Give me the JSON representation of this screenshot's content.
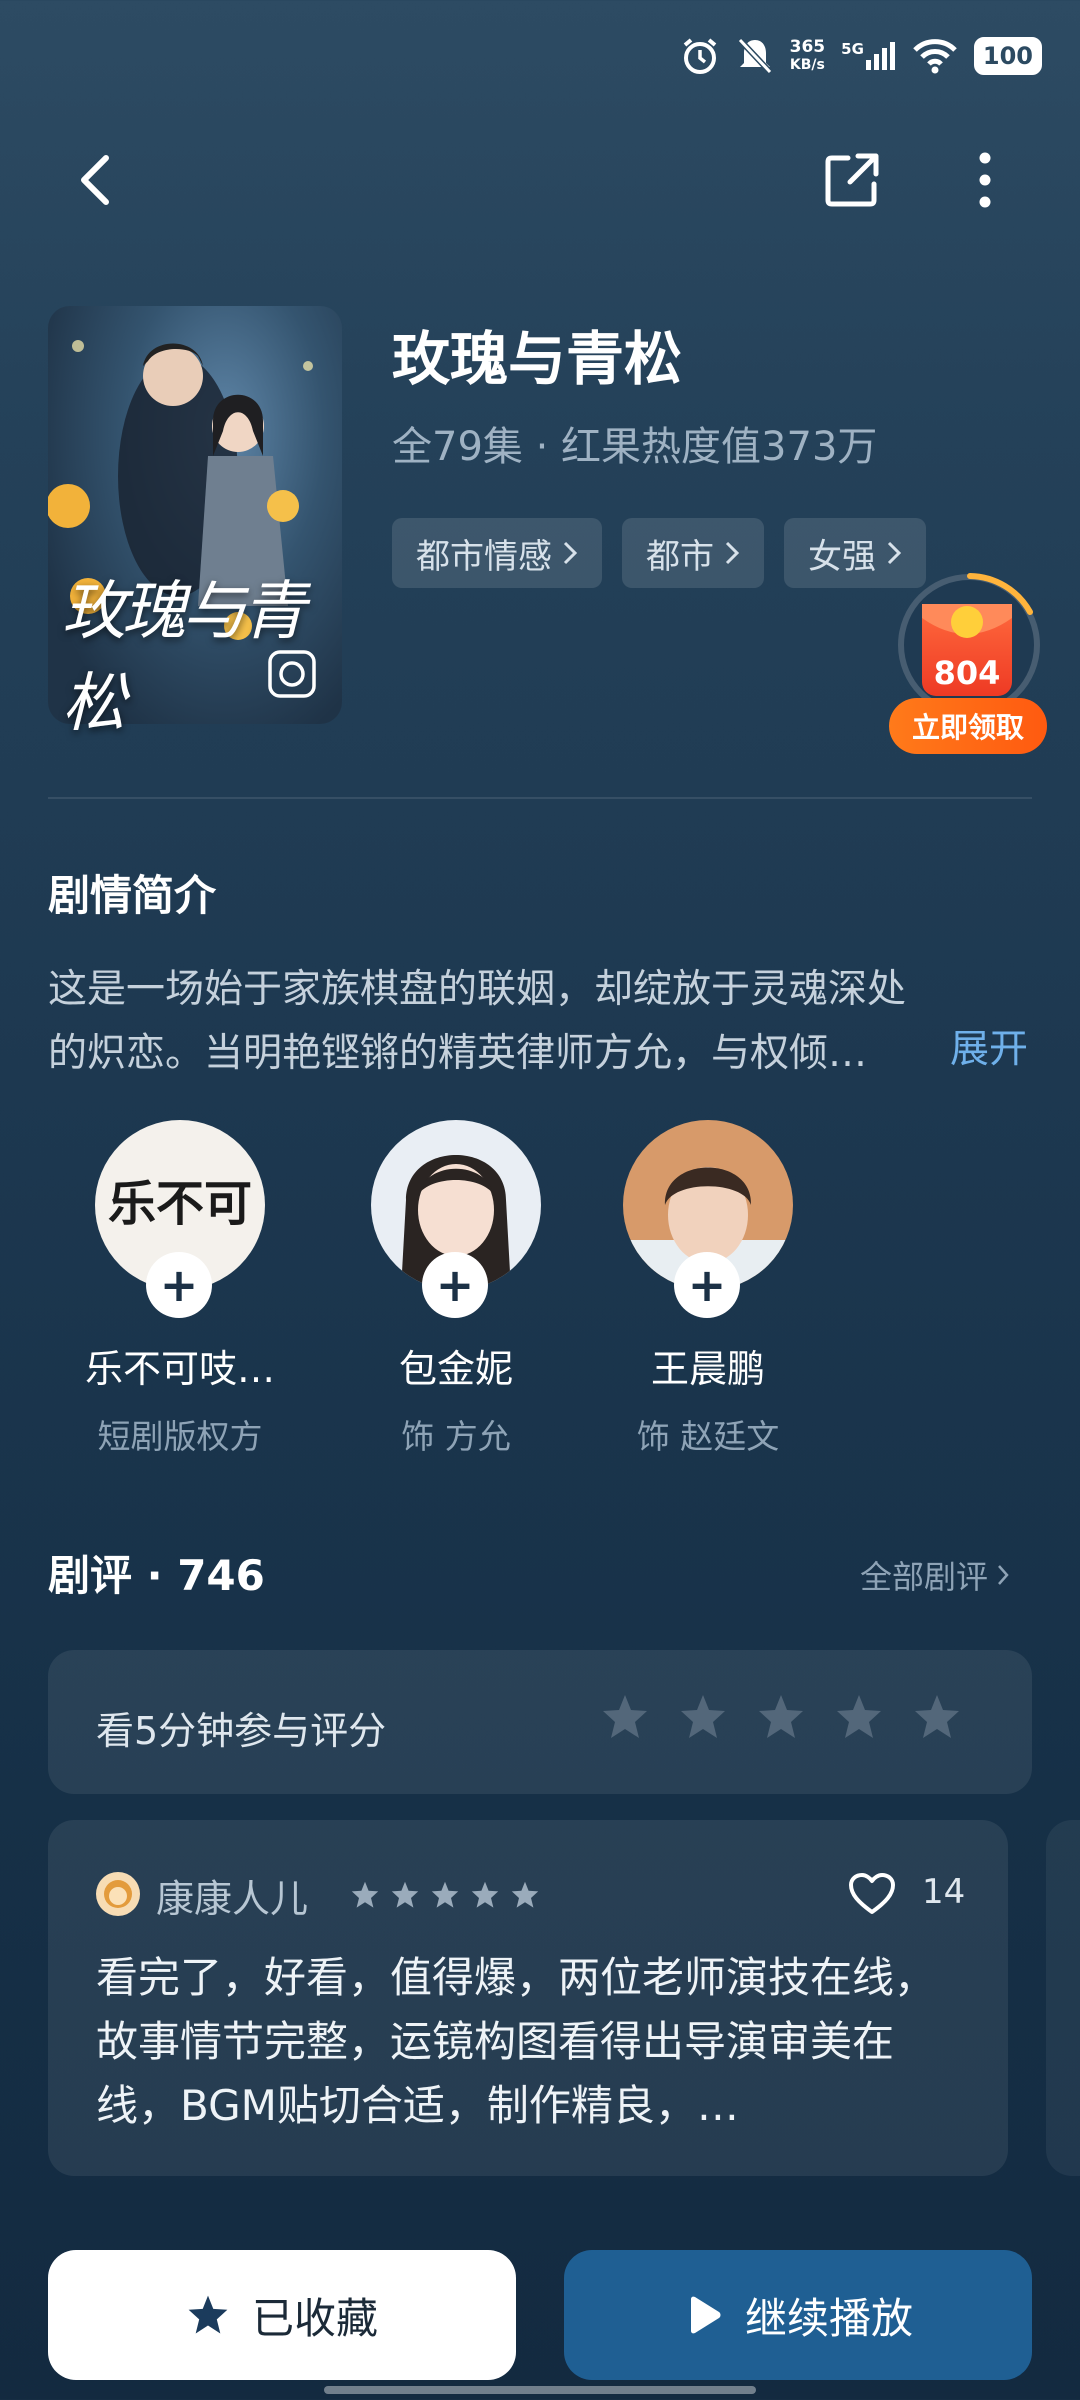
{
  "status_bar": {
    "speed_value": "365",
    "speed_unit": "KB/s",
    "network": "5G",
    "battery": "100"
  },
  "drama": {
    "title": "玫瑰与青松",
    "meta": "全79集 · 红果热度值373万",
    "poster_title": "玫瑰与青松",
    "tags": [
      "都市情感",
      "都市",
      "女强"
    ]
  },
  "reward": {
    "amount": "804",
    "button": "立即领取"
  },
  "synopsis": {
    "heading": "剧情简介",
    "text": "这是一场始于家族棋盘的联姻，却绽放于灵魂深处的炽恋。当明艳铿锵的精英律师方允，与权倾…",
    "expand": "展开"
  },
  "cast": [
    {
      "name": "乐不可吱…",
      "role": "短剧版权方"
    },
    {
      "name": "包金妮",
      "role": "饰 方允"
    },
    {
      "name": "王晨鹏",
      "role": "饰 赵廷文"
    }
  ],
  "reviews": {
    "heading": "剧评 · 746",
    "all_label": "全部剧评",
    "rate_prompt": "看5分钟参与评分",
    "comment": {
      "user": "康康人儿",
      "likes": "14",
      "text": "看完了，好看，值得爆，两位老师演技在线，故事情节完整，运镜构图看得出导演审美在线，BGM贴切合适，制作精良，…"
    }
  },
  "actions": {
    "favorite": "已收藏",
    "play": "继续播放"
  },
  "colors": {
    "accent": "#1f5f93",
    "link": "#6fb0ea",
    "reward": "#ff5a10"
  }
}
